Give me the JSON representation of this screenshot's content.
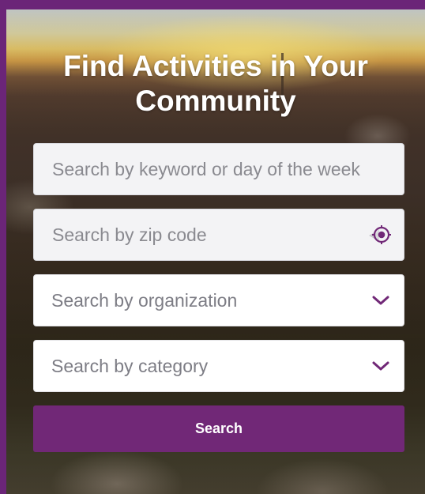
{
  "title": "Find Activities in Your Community",
  "keyword_search": {
    "placeholder": "Search by keyword or day of the week",
    "value": ""
  },
  "zip_search": {
    "placeholder": "Search by zip code",
    "value": "",
    "icon": "location-target-icon"
  },
  "organization_select": {
    "placeholder": "Search by organization",
    "icon": "chevron-down-icon"
  },
  "category_select": {
    "placeholder": "Search by category",
    "icon": "chevron-down-icon"
  },
  "search_button": {
    "label": "Search"
  },
  "colors": {
    "frame": "#6b2578",
    "accent": "#712877",
    "field_bg": "#f3f3f5",
    "select_bg": "#ffffff",
    "placeholder": "#8a8a90",
    "title_text": "#ffffff"
  }
}
